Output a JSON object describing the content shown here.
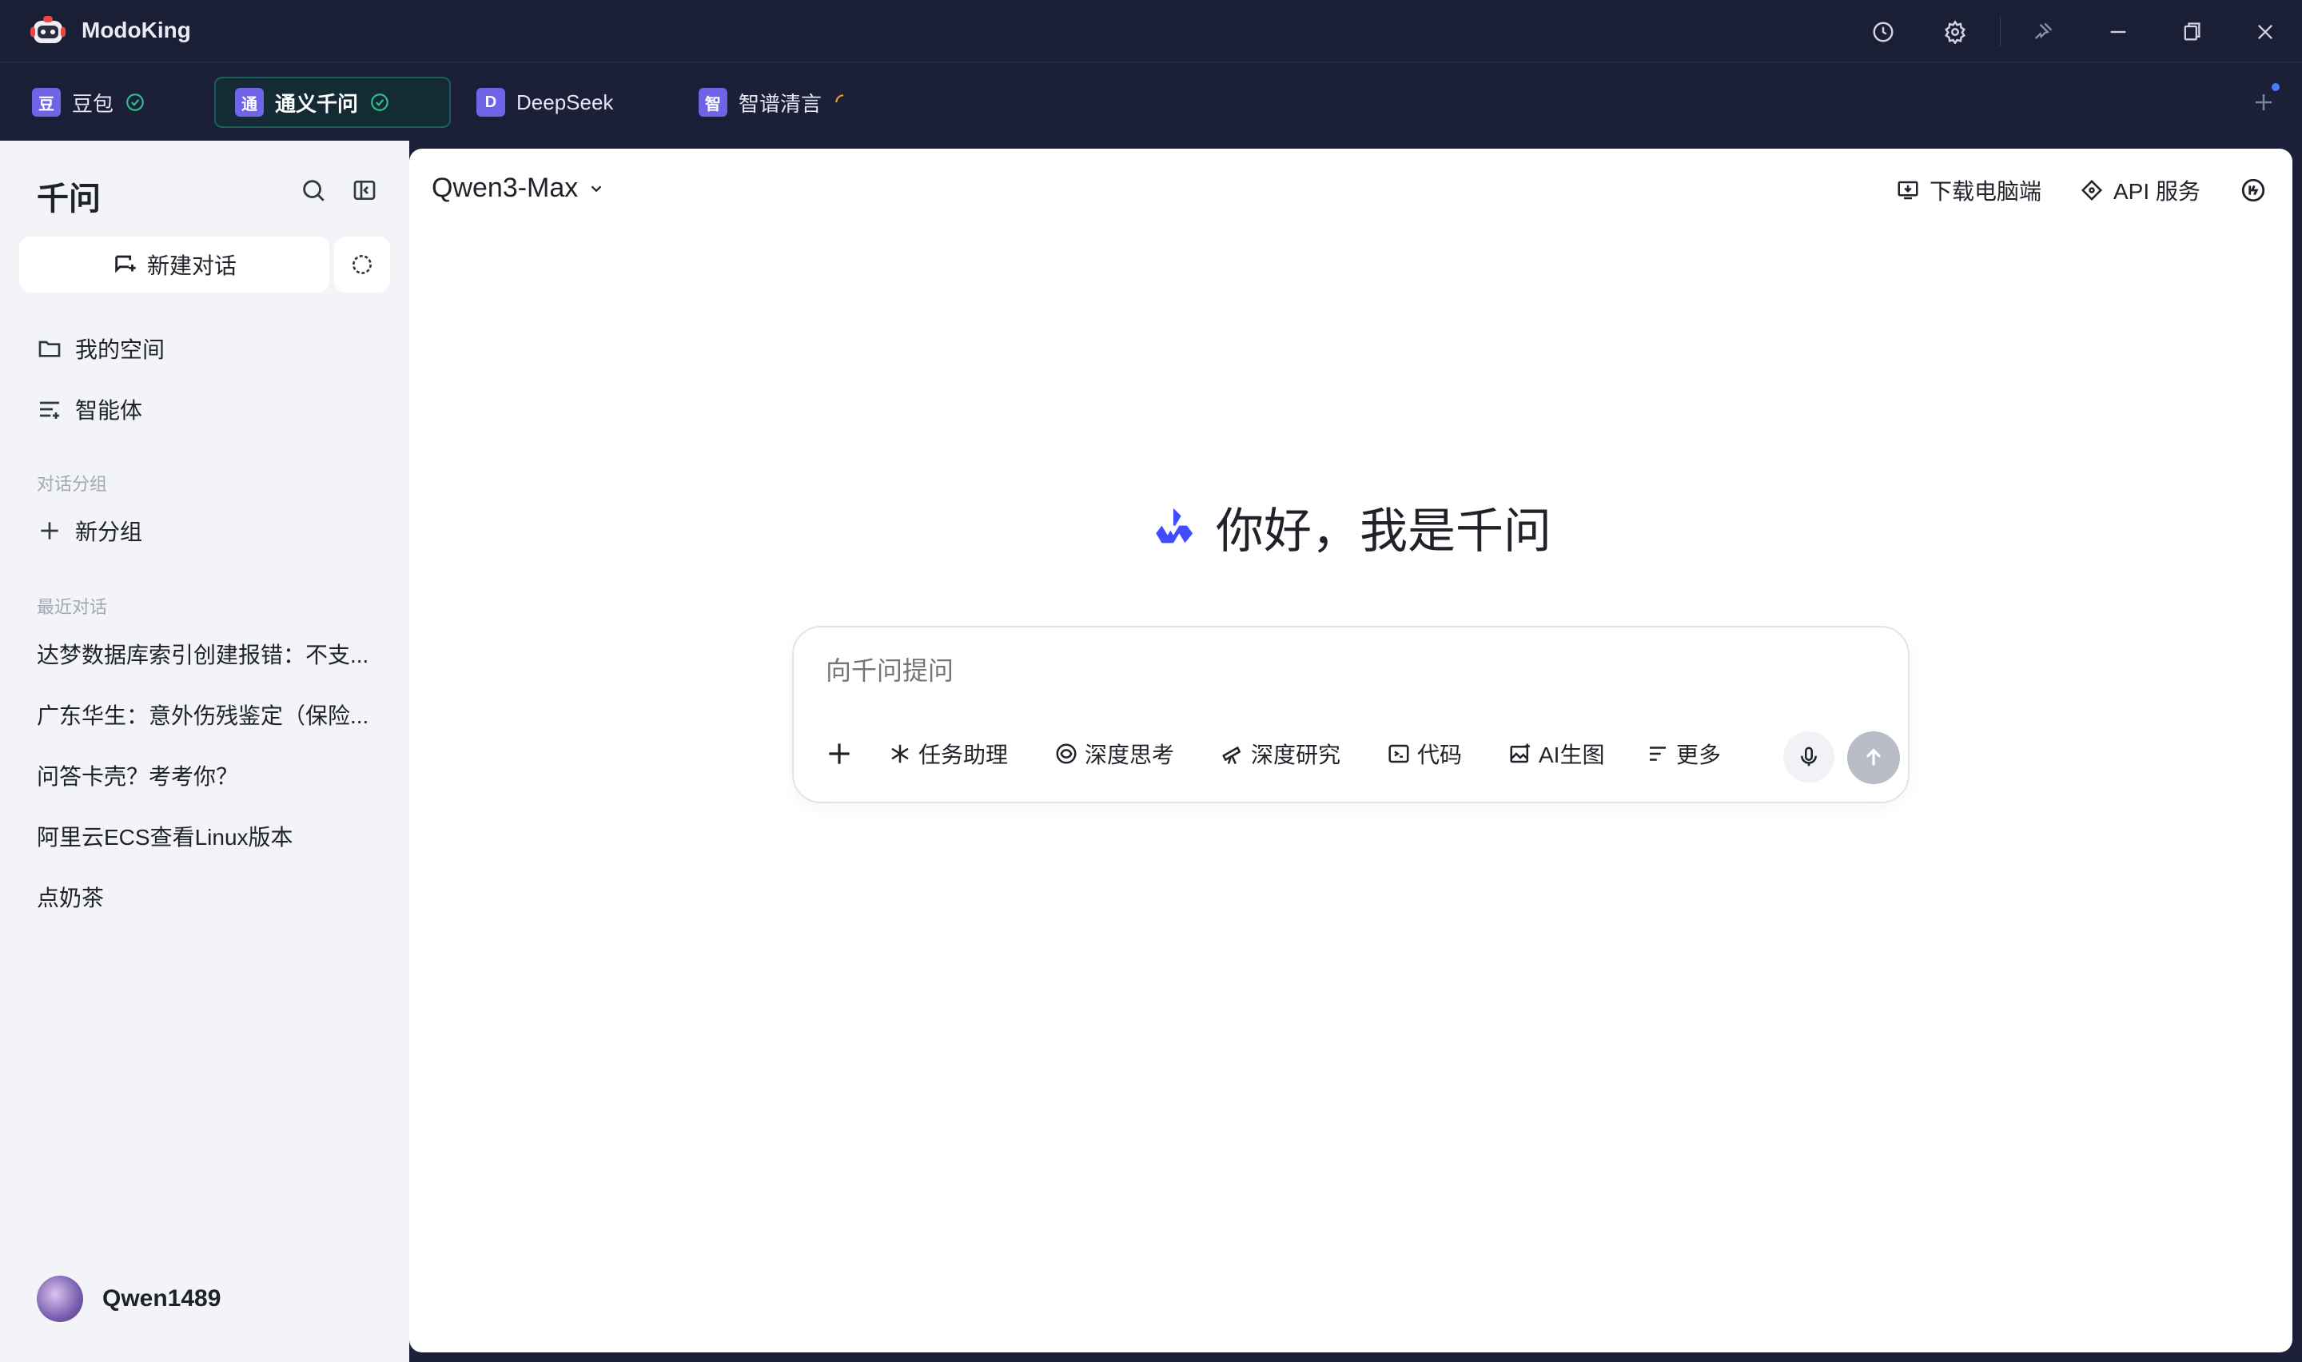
{
  "app": {
    "title": "ModoKing"
  },
  "window_controls": [
    "history-icon",
    "settings-icon",
    "pin-icon",
    "minimize-icon",
    "restore-icon",
    "close-icon"
  ],
  "tabs": [
    {
      "badge": "豆",
      "label": "豆包",
      "status": "ready"
    },
    {
      "badge": "通",
      "label": "通义千问",
      "status": "ready",
      "active": true
    },
    {
      "badge": "D",
      "label": "DeepSeek",
      "status": ""
    },
    {
      "badge": "智",
      "label": "智谱清言",
      "status": "loading"
    }
  ],
  "sidebar": {
    "title": "千问",
    "new_chat": "新建对话",
    "nav": [
      {
        "icon": "folder-icon",
        "label": "我的空间"
      },
      {
        "icon": "agent-list-icon",
        "label": "智能体"
      }
    ],
    "groups_section": "对话分组",
    "new_group": "新分组",
    "recent_section": "最近对话",
    "recent": [
      "达梦数据库索引创建报错：不支...",
      "广东华生：意外伤残鉴定（保险...",
      "问答卡壳？考考你？",
      "阿里云ECS查看Linux版本",
      "点奶茶"
    ],
    "user": {
      "name": "Qwen1489"
    }
  },
  "main": {
    "model": "Qwen3-Max",
    "actions": {
      "download": "下载电脑端",
      "api": "API 服务"
    },
    "greeting": "你好，我是千问",
    "input_placeholder": "向千问提问",
    "tools": [
      {
        "icon": "sparkle-icon",
        "label": "任务助理"
      },
      {
        "icon": "deep-think-icon",
        "label": "深度思考"
      },
      {
        "icon": "telescope-icon",
        "label": "深度研究"
      },
      {
        "icon": "code-icon",
        "label": "代码"
      },
      {
        "icon": "image-gen-icon",
        "label": "AI生图"
      },
      {
        "icon": "more-icon",
        "label": "更多"
      }
    ]
  },
  "colors": {
    "titlebar": "#1b1f35",
    "tab_badge": "#6f63e8",
    "status_ok": "#2fbf8a",
    "loading": "#f0a020",
    "brand": "#3d4dff"
  }
}
